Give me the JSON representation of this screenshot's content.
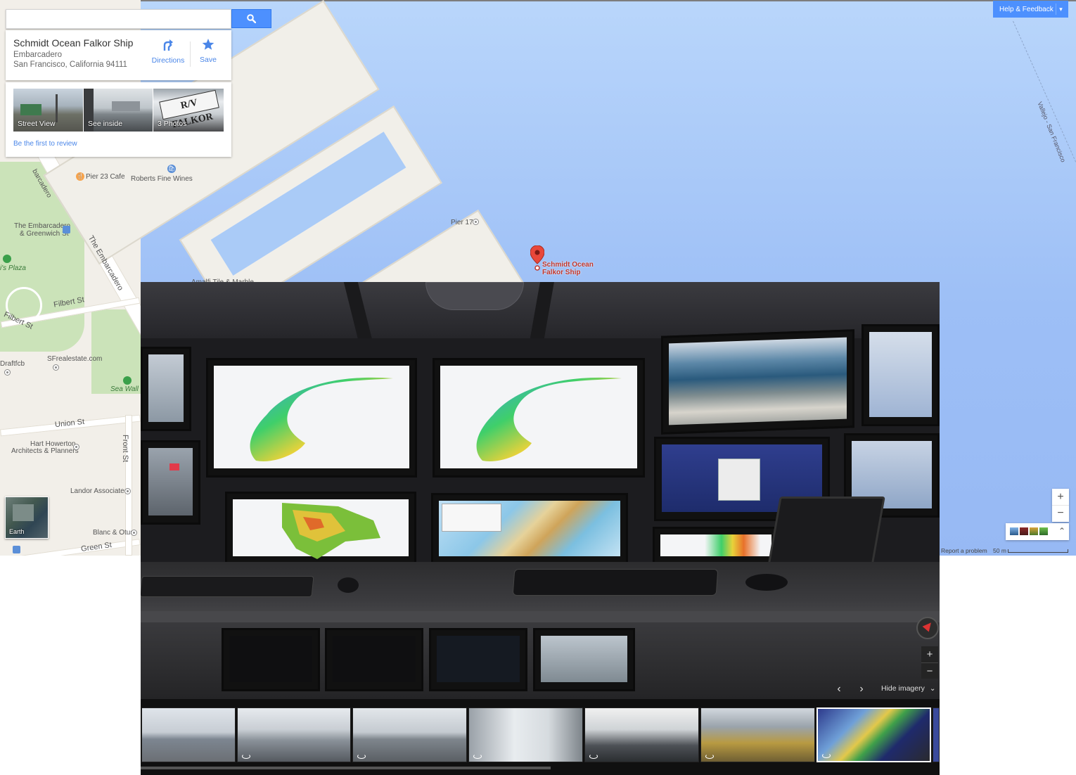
{
  "search": {
    "value": "",
    "placeholder": ""
  },
  "place": {
    "title": "Schmidt Ocean Falkor Ship",
    "address_line1": "Embarcadero",
    "address_line2": "San Francisco, California 94111",
    "directions_label": "Directions",
    "save_label": "Save",
    "photos": [
      {
        "label": "Street View"
      },
      {
        "label": "See inside"
      },
      {
        "label": "3 Photos"
      }
    ],
    "review_link": "Be the first to review"
  },
  "marker": {
    "line1": "Schmidt Ocean",
    "line2": "Falkor Ship"
  },
  "help": {
    "label": "Help & Feedback"
  },
  "map_labels": {
    "pier23": "Pier 23 Cafe",
    "roberts": "Roberts Fine Wines",
    "pier17": "Pier 17",
    "embarcadero_greenwich_1": "The Embarcadero",
    "embarcadero_greenwich_2": "& Greenwich St",
    "levis_plaza": "i's Plaza",
    "the_embarcadero": "The Embarcadero",
    "embarcadero_upper": "barcadero",
    "filbert1": "Filbert St",
    "filbert2": "Filbert St",
    "draftfcb": "Draftfcb",
    "sfrealestate": "SFrealestate.com",
    "seawall": "Sea Wall Lo",
    "union": "Union St",
    "hart1": "Hart Howerton",
    "hart2": "Architects & Planners",
    "front": "Front St",
    "landor": "Landor Associates",
    "blanc": "Blanc & Otus",
    "green": "Green St",
    "amalfi": "Amalfi Tile & Marble",
    "ferry": "Vallejo - San Francisco"
  },
  "earth_label": "Earth",
  "map_footer": {
    "report": "Report a problem",
    "scale": "50 m"
  },
  "pano": {
    "hide_imagery": "Hide imagery"
  },
  "colors": {
    "accent": "#4d90fe",
    "marker": "#c2362b",
    "water": "#a3c3f7"
  },
  "icons": [
    "search-icon",
    "directions-icon",
    "star-icon",
    "chevron-down-icon",
    "compass-icon",
    "chevron-left-icon",
    "chevron-right-icon",
    "double-chevron-up-icon",
    "double-chevron-down-icon",
    "street-view-icon"
  ]
}
